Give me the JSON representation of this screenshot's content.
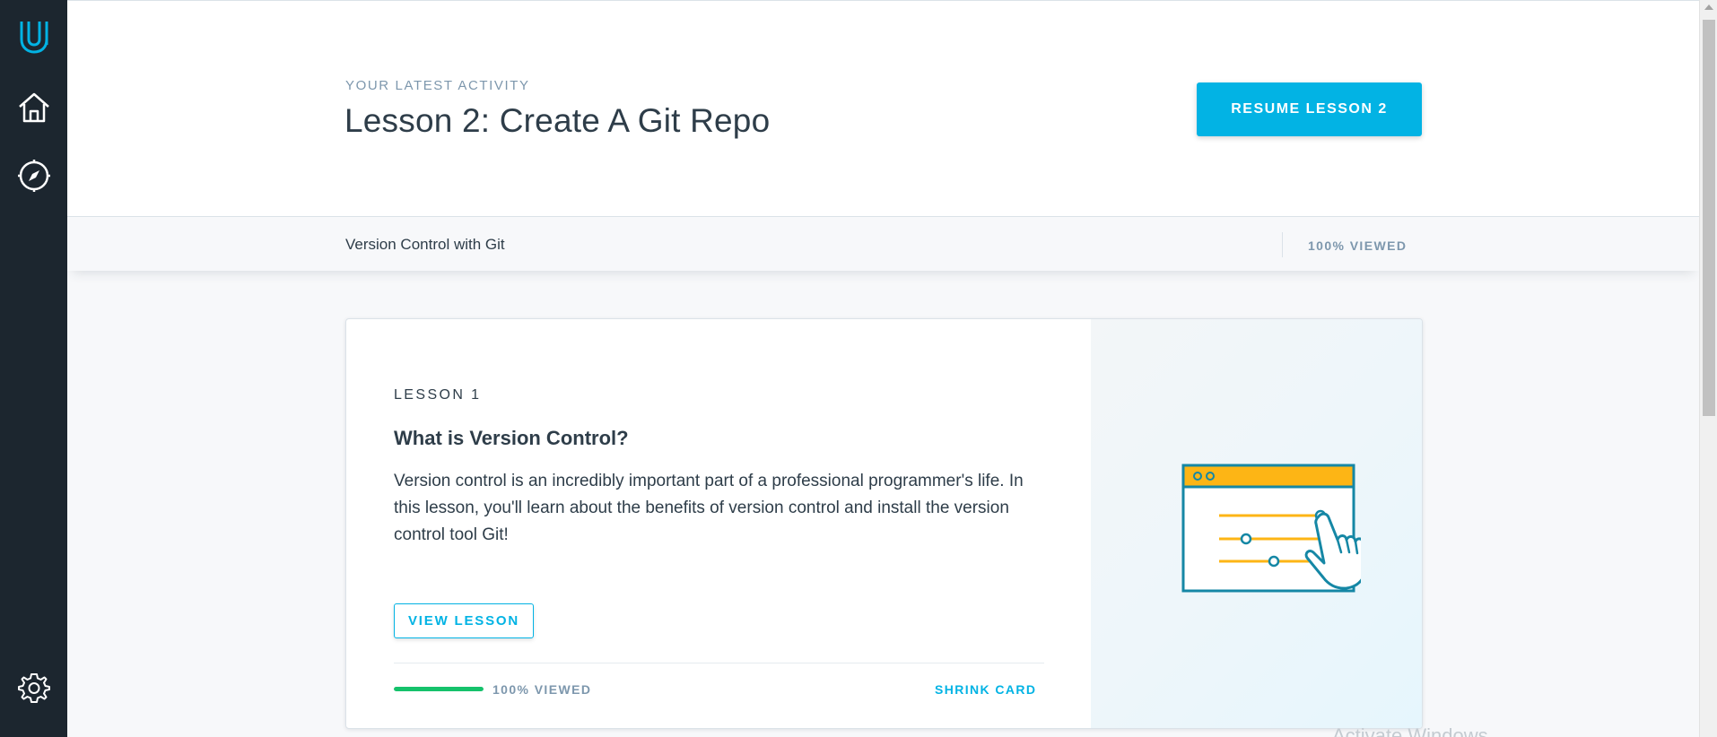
{
  "sidebar": {
    "items": [
      {
        "name": "udacity-logo-icon"
      },
      {
        "name": "home-icon"
      },
      {
        "name": "compass-icon"
      },
      {
        "name": "gear-icon"
      }
    ]
  },
  "hero": {
    "eyebrow": "YOUR LATEST ACTIVITY",
    "title": "Lesson 2: Create A Git Repo",
    "resume_label": "RESUME LESSON 2"
  },
  "course_bar": {
    "course_name": "Version Control with Git",
    "viewed": "100% VIEWED"
  },
  "card": {
    "lesson_no": "LESSON 1",
    "lesson_title": "What is Version Control?",
    "lesson_desc": "Version control is an incredibly important part of a professional programmer's life. In this lesson, you'll learn about the benefits of version control and install the version control tool Git!",
    "view_label": "VIEW LESSON",
    "progress_percent": 100,
    "progress_label": "100% VIEWED",
    "shrink_label": "SHRINK CARD",
    "illustration": "browser-sliders-hand-icon"
  },
  "watermark": "Activate Windows",
  "colors": {
    "sidebar_bg": "#1c262f",
    "accent": "#02b3e4",
    "progress": "#15c26b",
    "illustration_orange": "#fdb515",
    "illustration_teal": "#1587a5"
  }
}
